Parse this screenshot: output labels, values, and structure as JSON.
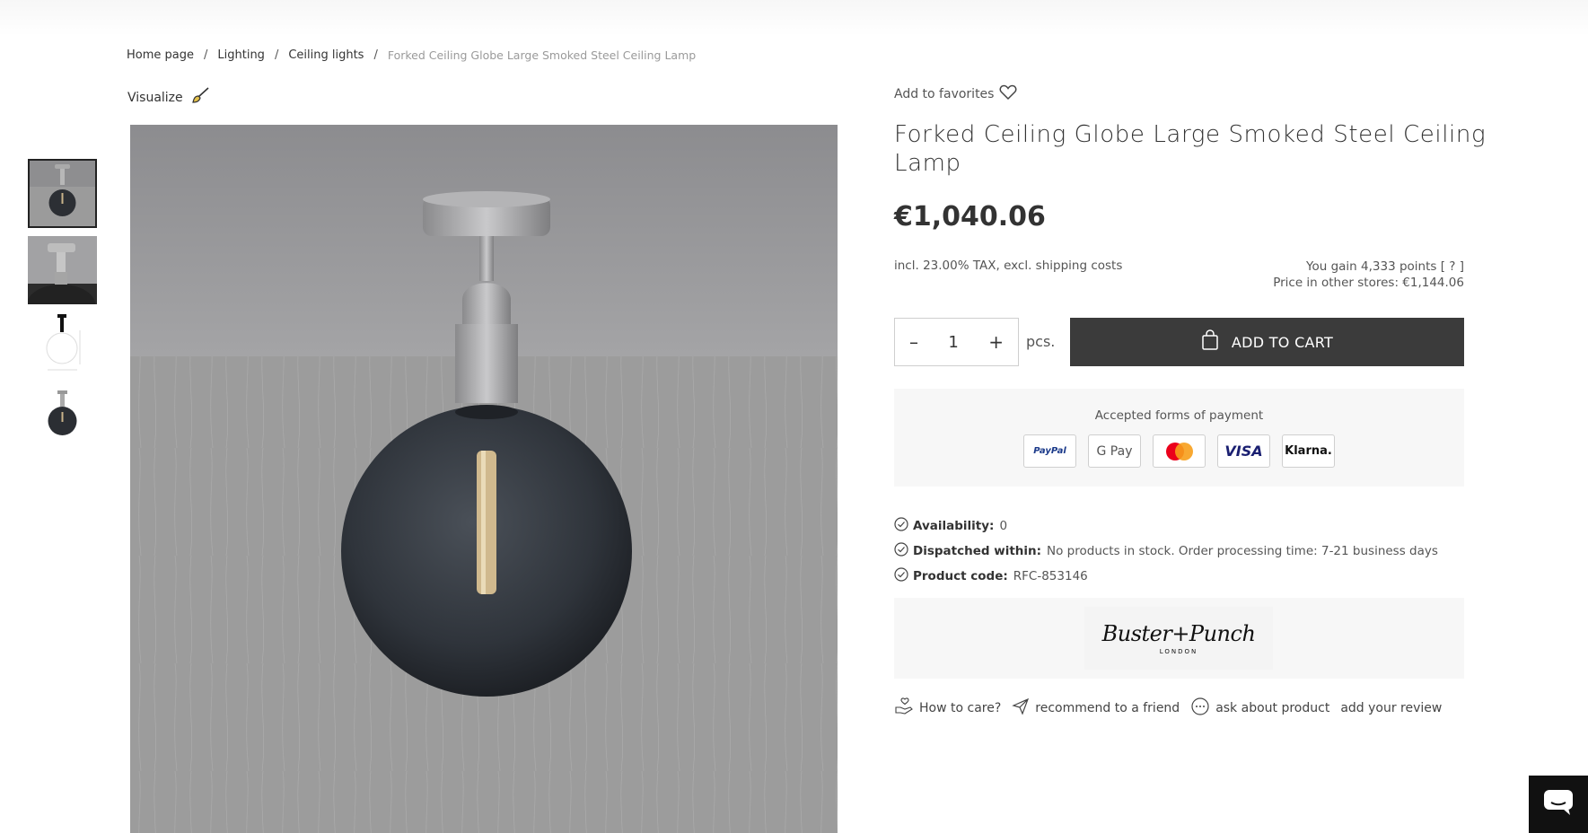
{
  "breadcrumb": {
    "items": [
      "Home page",
      "Lighting",
      "Ceiling lights"
    ],
    "separator": "/",
    "current": "Forked Ceiling Globe Large Smoked Steel Ceiling Lamp"
  },
  "visualize": {
    "label": "Visualize",
    "icon": "paintbrush-icon"
  },
  "gallery": {
    "thumbnails": [
      "lamp-front-view",
      "lamp-detail-view",
      "lamp-dimension-drawing",
      "lamp-studio-view"
    ],
    "selected_index": 0
  },
  "favorites": {
    "label": "Add to favorites",
    "icon": "heart-icon"
  },
  "product": {
    "title": "Forked Ceiling Globe Large Smoked Steel Ceiling Lamp",
    "price": "€1,040.06",
    "tax_note": "incl. 23.00% TAX, excl. shipping costs",
    "points_text": "You gain 4,333 points [ ? ]",
    "other_stores_text": "Price in other stores: €1,144.06"
  },
  "purchase": {
    "minus": "–",
    "quantity": "1",
    "plus": "+",
    "unit": "pcs.",
    "add_to_cart": "ADD TO CART"
  },
  "payments": {
    "label": "Accepted forms of payment",
    "methods": [
      "PayPal",
      "G Pay",
      "Mastercard",
      "VISA",
      "Klarna."
    ]
  },
  "details": {
    "availability_label": "Availability:",
    "availability_value": "0",
    "dispatch_label": "Dispatched within:",
    "dispatch_value": "No products in stock. Order processing time: 7-21 business days",
    "code_label": "Product code:",
    "code_value": "RFC-853146"
  },
  "brand": {
    "name": "Buster+Punch",
    "subtitle": "LONDON"
  },
  "actions": {
    "care": "How to care?",
    "recommend": "recommend to a friend",
    "ask": "ask about product",
    "review": "add your review"
  },
  "colors": {
    "cart_bg": "#3b3b3b",
    "panel_bg": "#f7f7f7",
    "chat_bg": "#111111"
  }
}
